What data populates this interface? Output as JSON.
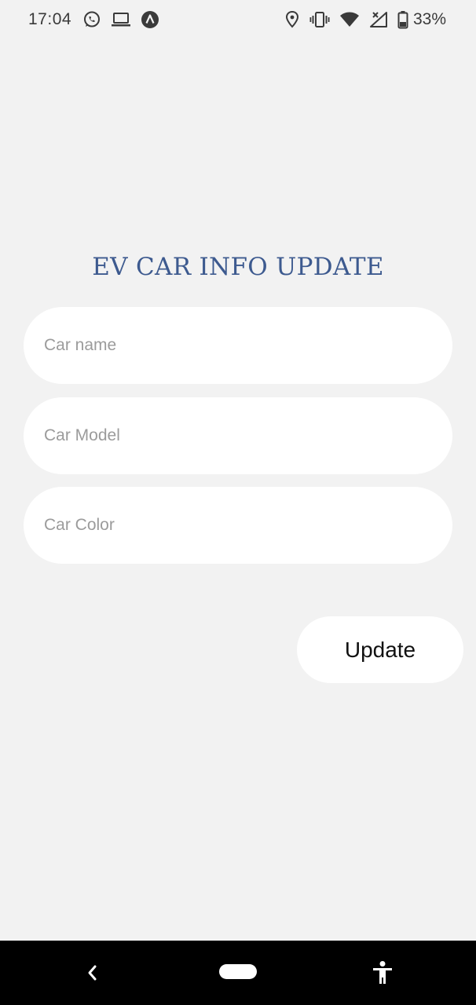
{
  "status_bar": {
    "time": "17:04",
    "battery_percent": "33%",
    "left_icons": [
      "whatsapp-icon",
      "laptop-icon",
      "app-a-icon"
    ],
    "right_icons": [
      "location-icon",
      "vibrate-icon",
      "wifi-icon",
      "signal-icon",
      "battery-icon"
    ]
  },
  "form": {
    "title": "EV CAR INFO UPDATE",
    "fields": [
      {
        "placeholder": "Car name",
        "value": ""
      },
      {
        "placeholder": "Car Model",
        "value": ""
      },
      {
        "placeholder": "Car Color",
        "value": ""
      }
    ],
    "submit_label": "Update"
  },
  "nav_bar": {
    "icons": [
      "back-icon",
      "home-pill-icon",
      "accessibility-icon"
    ]
  },
  "colors": {
    "background": "#f2f2f2",
    "title": "#3d5a8f",
    "field_bg": "#ffffff",
    "nav_bg": "#000000"
  }
}
